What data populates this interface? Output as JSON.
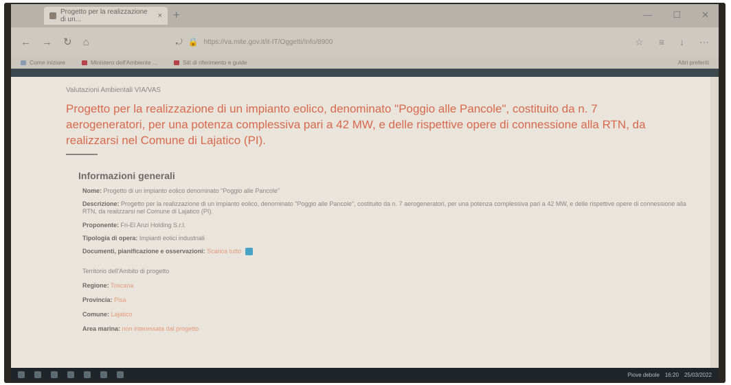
{
  "browser": {
    "tab_title": "Progetto per la realizzazione di un...",
    "tab_close": "×",
    "new_tab": "+",
    "window_controls": [
      "—",
      "☐",
      "✕"
    ],
    "nav_icons": [
      "←",
      "→",
      "↻",
      "⌂"
    ],
    "address": "https://va.mite.gov.it/it-IT/Oggetti/Info/8900",
    "address_icons": [
      "⤾",
      "🔒"
    ],
    "right_icons": [
      "☆",
      "≡",
      "↓",
      "⋯"
    ],
    "bookmarks": [
      "Come iniziare",
      "Ministero dell'Ambiente ...",
      "Siti di riferimento e guide"
    ],
    "bookmarks_right": "Altri preferiti"
  },
  "page": {
    "breadcrumb": "Valutazioni Ambientali VIA/VAS",
    "title": "Progetto per la realizzazione di un impianto eolico, denominato \"Poggio alle Pancole\", costituito da n. 7 aerogeneratori, per una potenza complessiva pari a 42 MW, e delle rispettive opere di connessione alla RTN, da realizzarsi nel Comune di Lajatico (PI).",
    "section_title": "Informazioni generali",
    "fields": {
      "name_label": "Nome:",
      "name_value": "Progetto di un impianto eolico denominato \"Poggio alle Pancole\"",
      "desc_label": "Descrizione:",
      "desc_value": "Progetto per la realizzazione di un impianto eolico, denominato \"Poggio alle Pancole\", costituito da n. 7 aerogeneratori, per una potenza complessiva pari a 42 MW, e delle rispettive opere di connessione alla RTN, da realizzarsi nel Comune di Lajatico (PI).",
      "proponent_label": "Proponente:",
      "proponent_value": "Fri-El Anzi Holding S.r.l.",
      "type_label": "Tipologia di opera:",
      "type_value": "Impianti eolici industriali",
      "class_label": "Documenti, pianificazione e osservazioni:",
      "class_value": "Scarica tutto"
    },
    "location_intro": "Territorio dell'Ambito di progetto",
    "location": {
      "region_label": "Regione:",
      "region_value": "Toscana",
      "province_label": "Provincia:",
      "province_value": "Pisa",
      "comune_label": "Comune:",
      "comune_value": "Lajatico",
      "area_label": "Area marina:",
      "area_value": "non interessata dal progetto"
    }
  },
  "taskbar": {
    "tray_text": "Piove debole",
    "time": "16:20",
    "date": "25/03/2022"
  }
}
